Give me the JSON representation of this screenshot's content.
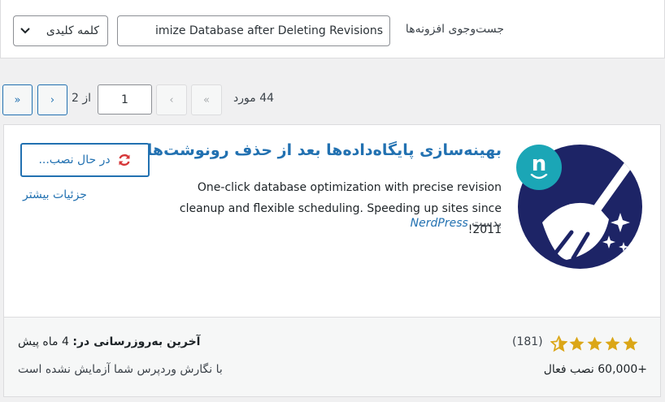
{
  "search": {
    "label": "جست‌وجوی افزونه‌ها",
    "value": "imize Database after Deleting Revisions",
    "type_select": "کلمه کلیدی"
  },
  "pagination": {
    "count_text": "44 مورد",
    "first": "«",
    "prev": "‹",
    "current_page": "1",
    "of_text": "از 2",
    "next": "›",
    "last": "»"
  },
  "plugin": {
    "title": "بهینه‌سازی پایگاه‌داده‌ها بعد از حذف رونوشت‌ها",
    "description": "One-click database optimization with precise revision cleanup and flexible scheduling. Speeding up sites since 2011!",
    "author_prefix": "بدست",
    "author_name": "NerdPress",
    "install_label": "در حال نصب...",
    "more_details": "جزئیات بیشتر",
    "icon_letter": "n",
    "rating_stars": 5,
    "ratings_count": "(181)",
    "active_installs": "+60,000 نصب فعال",
    "last_updated_label": "آخرین به‌روزرسانی در:",
    "last_updated_value": "4 ماه پیش",
    "compatibility": "با نگارش وردپرس شما آزمایش نشده است"
  },
  "colors": {
    "accent": "#2271b1",
    "icon_bg": "#1d2466",
    "icon_badge": "#1ba6b6",
    "star": "#dba617",
    "spinner": "#d63638"
  }
}
